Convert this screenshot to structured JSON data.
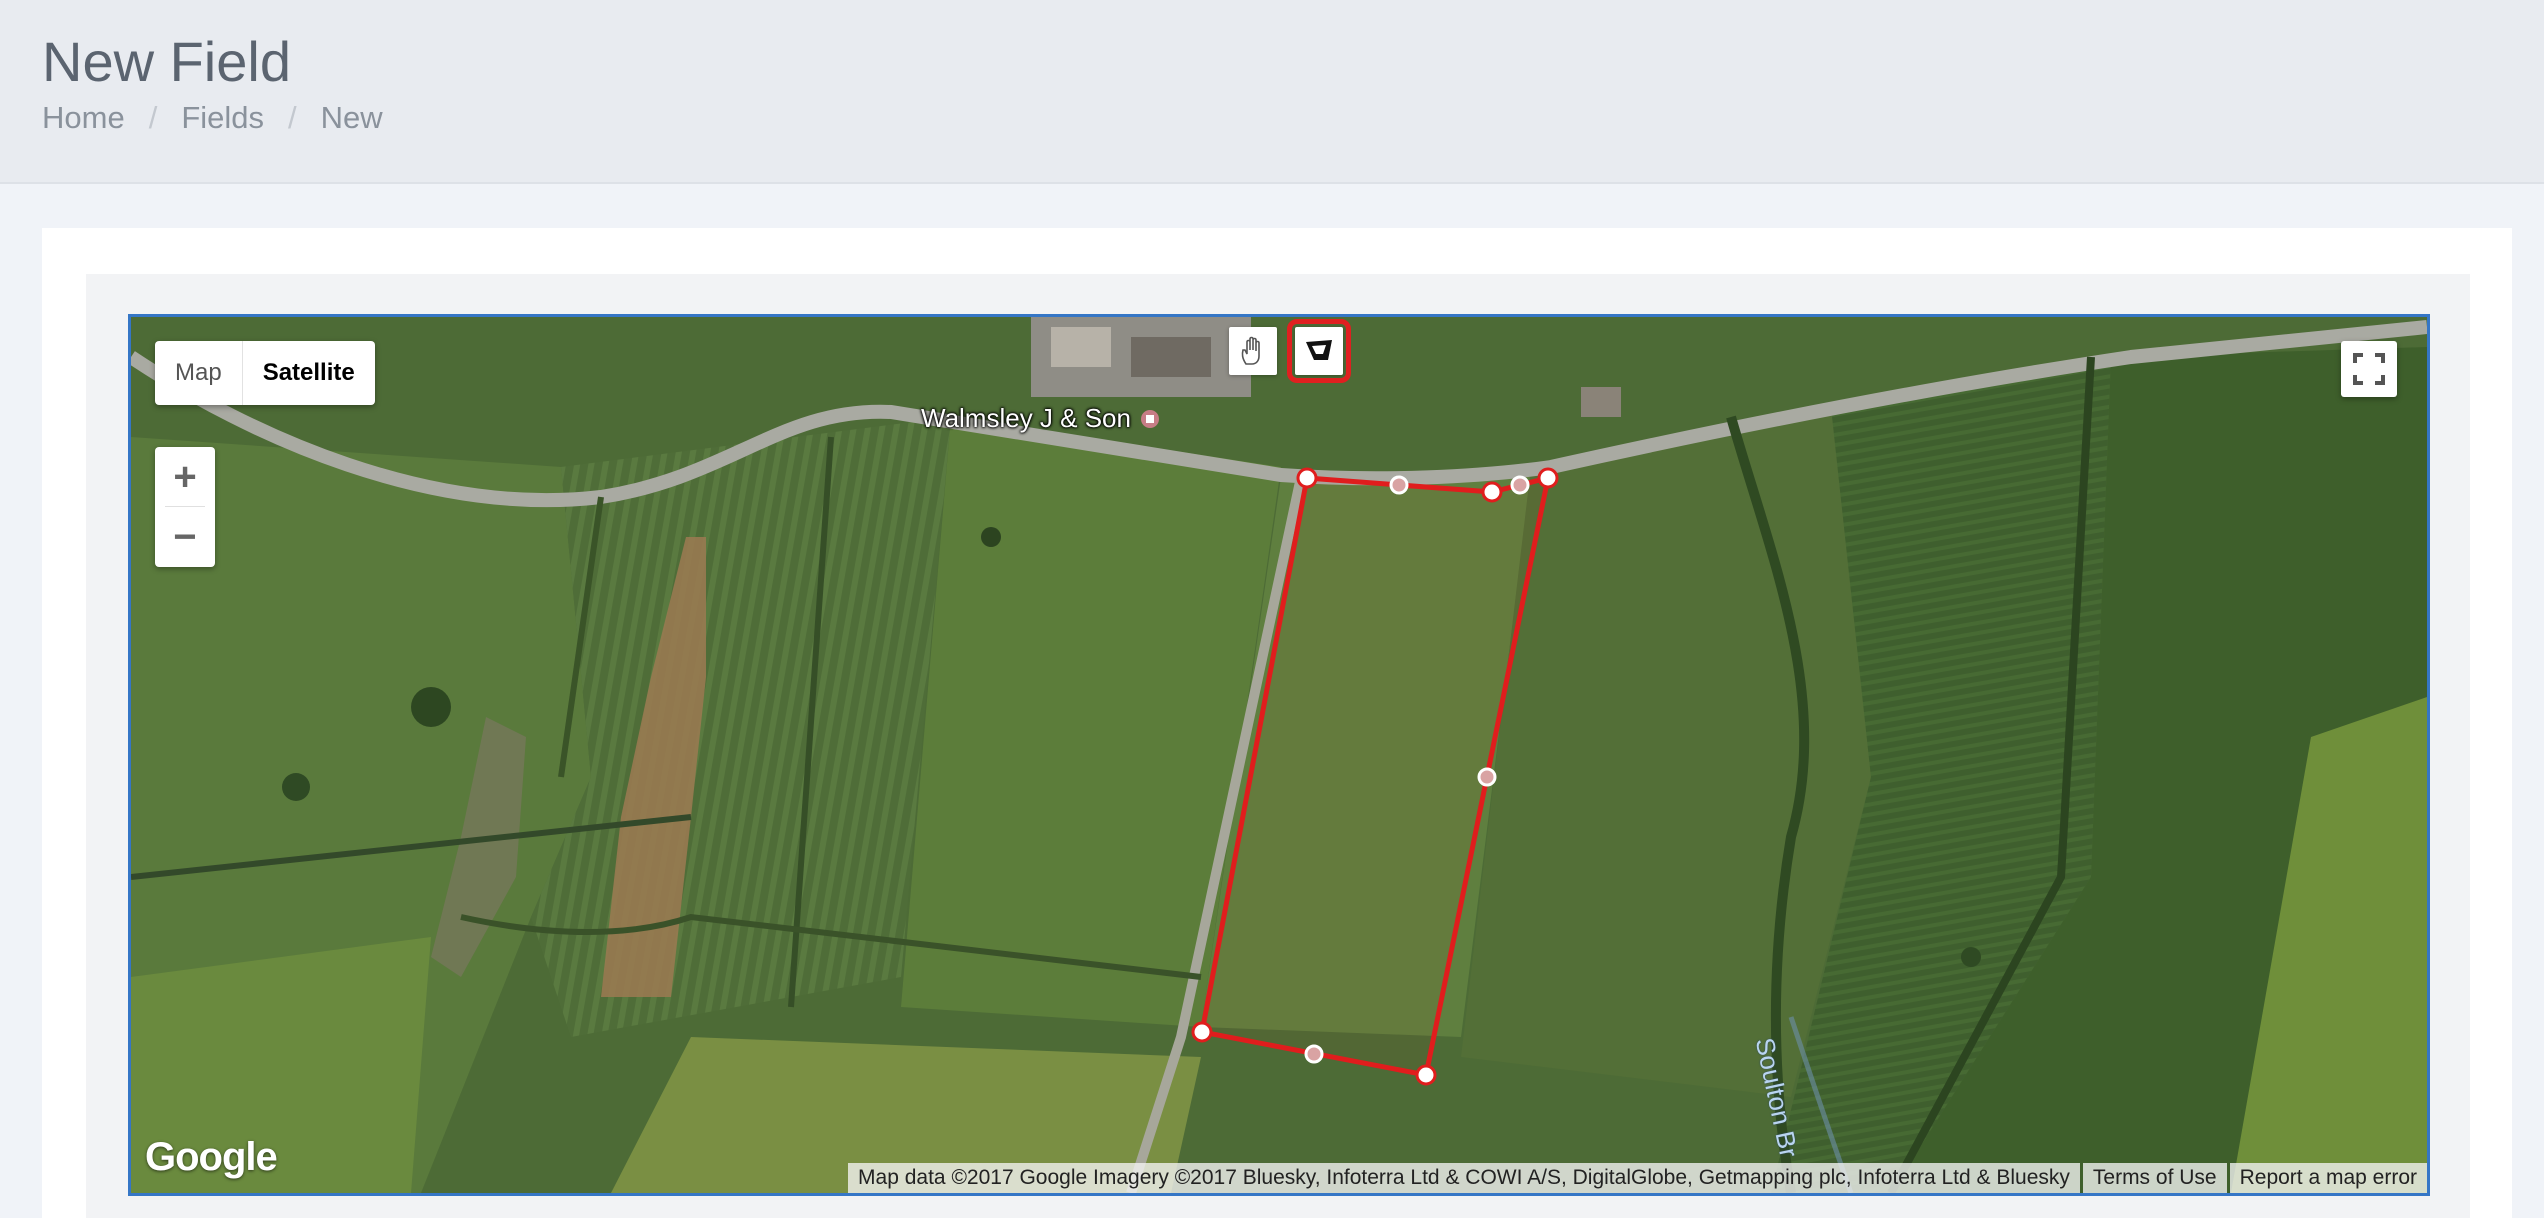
{
  "header": {
    "title": "New Field",
    "breadcrumb": [
      {
        "label": "Home"
      },
      {
        "label": "Fields"
      },
      {
        "label": "New"
      }
    ],
    "separator": "/"
  },
  "map": {
    "type_control": {
      "options": [
        "Map",
        "Satellite"
      ],
      "selected": "Satellite"
    },
    "zoom": {
      "in_label": "+",
      "out_label": "−"
    },
    "drawing_tools": [
      {
        "name": "hand-icon",
        "selected": false
      },
      {
        "name": "polygon-icon",
        "selected": true
      }
    ],
    "labels": {
      "farm": "Walmsley J & Son",
      "creek": "Soulton Br"
    },
    "logo": "Google",
    "attribution": {
      "data": "Map data ©2017 Google Imagery ©2017 Bluesky, Infoterra Ltd & COWI A/S, DigitalGlobe, Getmapping plc, Infoterra Ltd & Bluesky",
      "terms": "Terms of Use",
      "report": "Report a map error"
    },
    "colors": {
      "polygon_stroke": "#e01d1d",
      "accent_border": "#3576c6"
    }
  }
}
